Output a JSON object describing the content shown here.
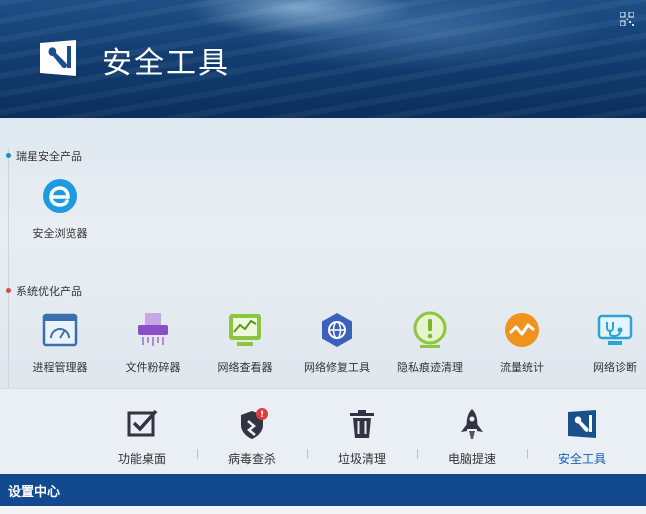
{
  "header": {
    "title": "安全工具"
  },
  "sections": [
    {
      "label": "瑞星安全产品",
      "tools": [
        {
          "label": "安全浏览器",
          "icon": "browser-e-icon"
        }
      ]
    },
    {
      "label": "系统优化产品",
      "tools": [
        {
          "label": "进程管理器",
          "icon": "process-manager-icon"
        },
        {
          "label": "文件粉碎器",
          "icon": "file-shredder-icon"
        },
        {
          "label": "网络查看器",
          "icon": "network-viewer-icon"
        },
        {
          "label": "网络修复工具",
          "icon": "network-repair-icon"
        },
        {
          "label": "隐私痕迹清理",
          "icon": "privacy-cleaner-icon"
        },
        {
          "label": "流量统计",
          "icon": "traffic-stats-icon"
        },
        {
          "label": "网络诊断",
          "icon": "network-diagnose-icon"
        }
      ]
    }
  ],
  "nav": [
    {
      "label": "功能桌面",
      "icon": "checkbox-icon"
    },
    {
      "label": "病毒查杀",
      "icon": "virus-scan-icon",
      "badge": "!"
    },
    {
      "label": "垃圾清理",
      "icon": "trash-icon"
    },
    {
      "label": "电脑提速",
      "icon": "rocket-icon"
    },
    {
      "label": "安全工具",
      "icon": "security-tools-icon",
      "active": true
    }
  ],
  "footer": {
    "label": "设置中心"
  },
  "colors": {
    "accent": "#13498e",
    "active_text": "#1a5fb4",
    "header_bg": "#123e72"
  }
}
